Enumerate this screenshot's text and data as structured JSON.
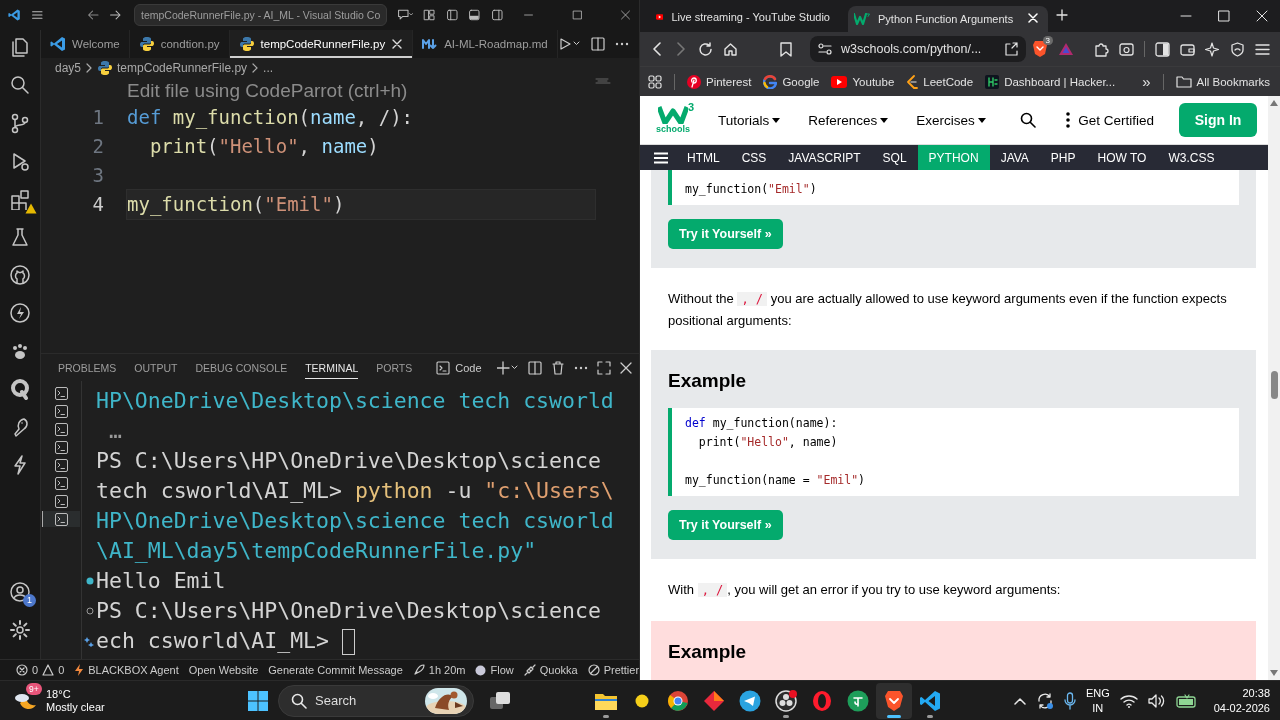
{
  "vscode": {
    "title": "tempCodeRunnerFile.py - AI_ML - Visual Studio Co",
    "extensions_warning": true,
    "account_badge": "1",
    "tabs": [
      {
        "label": "Welcome",
        "kind": "welcome",
        "selected": false
      },
      {
        "label": "condtion.py",
        "kind": "python",
        "selected": false
      },
      {
        "label": "tempCodeRunnerFile.py",
        "kind": "python",
        "selected": true
      },
      {
        "label": "AI-ML-Roadmap.md",
        "kind": "markdown",
        "selected": false
      }
    ],
    "breadcrumb": [
      "day5",
      "tempCodeRunnerFile.py",
      "..."
    ],
    "hint": "Edit file using CodeParrot (ctrl+h)",
    "lines": [
      {
        "number": "1",
        "current": false,
        "tokens": [
          {
            "kind": "kw",
            "text": "def "
          },
          {
            "kind": "fn",
            "text": "my_function"
          },
          {
            "kind": "plain",
            "text": "("
          },
          {
            "kind": "param",
            "text": "name"
          },
          {
            "kind": "plain",
            "text": ", /):"
          }
        ]
      },
      {
        "number": "2",
        "current": false,
        "tokens": [
          {
            "kind": "fn",
            "text": "  print"
          },
          {
            "kind": "plain",
            "text": "("
          },
          {
            "kind": "str",
            "text": "\"Hello\""
          },
          {
            "kind": "plain",
            "text": ", "
          },
          {
            "kind": "param",
            "text": "name"
          },
          {
            "kind": "plain",
            "text": ")"
          }
        ]
      },
      {
        "number": "3",
        "current": false
      },
      {
        "number": "4",
        "current": true,
        "tokens": [
          {
            "kind": "fn",
            "text": "my_function"
          },
          {
            "kind": "plain",
            "text": "("
          },
          {
            "kind": "str",
            "text": "\"Emil\""
          },
          {
            "kind": "plain",
            "text": ")"
          }
        ]
      }
    ],
    "panel_tabs": [
      {
        "label": "PROBLEMS",
        "selected": false
      },
      {
        "label": "OUTPUT",
        "selected": false
      },
      {
        "label": "DEBUG CONSOLE",
        "selected": false
      },
      {
        "label": "TERMINAL",
        "selected": true
      },
      {
        "label": "PORTS",
        "selected": false
      }
    ],
    "terminal_label": "Code",
    "terminal_instances": [
      {
        "selected": false
      },
      {
        "selected": false
      },
      {
        "selected": false
      },
      {
        "selected": false
      },
      {
        "selected": false
      },
      {
        "selected": false
      },
      {
        "selected": false
      },
      {
        "selected": true
      }
    ],
    "terminal_lines": [
      {
        "kind": "output",
        "segments": [
          {
            "kind": "path",
            "text": "HP\\OneDrive\\Desktop\\science tech csworld"
          }
        ]
      },
      {
        "kind": "output",
        "segments": [
          {
            "kind": "dim",
            "text": " …"
          }
        ]
      },
      {
        "kind": "output",
        "segments": [
          {
            "kind": "plain",
            "text": "PS C:\\Users\\HP\\OneDrive\\Desktop\\science"
          }
        ]
      },
      {
        "kind": "output",
        "segments": [
          {
            "kind": "plain",
            "text": "tech csworld\\AI_ML> "
          },
          {
            "kind": "cmd",
            "text": "python"
          },
          {
            "kind": "plain",
            "text": " -u "
          },
          {
            "kind": "str",
            "text": "\"c:\\Users\\"
          }
        ]
      },
      {
        "kind": "output",
        "segments": [
          {
            "kind": "path",
            "text": "HP\\OneDrive\\Desktop\\science tech csworld"
          }
        ]
      },
      {
        "kind": "output",
        "segments": [
          {
            "kind": "path",
            "text": "\\AI_ML\\day5\\tempCodeRunnerFile.py\""
          }
        ]
      },
      {
        "kind": "success",
        "segments": [
          {
            "kind": "plain",
            "text": "Hello Emil"
          }
        ]
      },
      {
        "kind": "idle",
        "segments": [
          {
            "kind": "plain",
            "text": "PS C:\\Users\\HP\\OneDrive\\Desktop\\science"
          }
        ]
      },
      {
        "kind": "sparkle",
        "cursor": true,
        "segments": [
          {
            "kind": "plain",
            "text": "ech csworld\\AI_ML> "
          }
        ]
      }
    ],
    "status_items": [
      {
        "kind": "problems",
        "errors": "0",
        "warnings": "0"
      },
      {
        "kind": "agent",
        "label": "BLACKBOX Agent"
      },
      {
        "kind": "text",
        "label": "Open Website"
      },
      {
        "kind": "text",
        "label": "Generate Commit Message"
      },
      {
        "kind": "timer",
        "label": "1h 20m"
      },
      {
        "kind": "flow",
        "label": "Flow"
      },
      {
        "kind": "plug",
        "label": "Quokka"
      },
      {
        "kind": "prettier",
        "label": "Prettier"
      }
    ]
  },
  "browser": {
    "tabs": [
      {
        "title": "Live streaming - YouTube Studio",
        "kind": "youtube",
        "selected": false
      },
      {
        "title": "Python Function Arguments",
        "kind": "w3",
        "selected": true
      }
    ],
    "url": "w3schools.com/python/...",
    "shield_count": "3",
    "bookmarks": [
      {
        "label": "Pinterest",
        "kind": "pinterest"
      },
      {
        "label": "Google",
        "kind": "google"
      },
      {
        "label": "Youtube",
        "kind": "youtube"
      },
      {
        "label": "LeetCode",
        "kind": "leetcode"
      },
      {
        "label": "Dashboard | Hacker...",
        "kind": "hacker"
      }
    ],
    "bookmarks_more": "»",
    "all_bookmarks": "All Bookmarks"
  },
  "page": {
    "logo": {
      "sup": "3",
      "word": "schools"
    },
    "menus": [
      "Tutorials",
      "References",
      "Exercises"
    ],
    "get_certified": "Get Certified",
    "sign_in": "Sign In",
    "subnav": [
      {
        "label": "HTML",
        "selected": false
      },
      {
        "label": "CSS",
        "selected": false
      },
      {
        "label": "JAVASCRIPT",
        "selected": false
      },
      {
        "label": "SQL",
        "selected": false
      },
      {
        "label": "PYTHON",
        "selected": true
      },
      {
        "label": "JAVA",
        "selected": false
      },
      {
        "label": "PHP",
        "selected": false
      },
      {
        "label": "HOW TO",
        "selected": false
      },
      {
        "label": "W3.CSS",
        "selected": false
      }
    ],
    "blocks": [
      {
        "kind": "example",
        "code": [
          {
            "kind": "code",
            "tokens": [
              {
                "kind": "plain",
                "text": "my_function("
              },
              {
                "kind": "str",
                "text": "\"Emil\""
              },
              {
                "kind": "plain",
                "text": ")"
              }
            ]
          }
        ],
        "button": "Try it Yourself »"
      },
      {
        "kind": "paragraph",
        "parts": [
          {
            "kind": "text",
            "text": "Without the "
          },
          {
            "kind": "code",
            "text": ", /"
          },
          {
            "kind": "text",
            "text": " you are actually allowed to use keyword arguments even if the function expects positional arguments:"
          }
        ]
      },
      {
        "kind": "example",
        "heading": "Example",
        "code": [
          {
            "kind": "code",
            "tokens": [
              {
                "kind": "kw",
                "text": "def"
              },
              {
                "kind": "plain",
                "text": " my_function(name):"
              }
            ]
          },
          {
            "kind": "code",
            "tokens": [
              {
                "kind": "plain",
                "text": "  print("
              },
              {
                "kind": "str",
                "text": "\"Hello\""
              },
              {
                "kind": "plain",
                "text": ", name)"
              }
            ]
          },
          {
            "kind": "blank"
          },
          {
            "kind": "code",
            "tokens": [
              {
                "kind": "plain",
                "text": "my_function(name = "
              },
              {
                "kind": "str",
                "text": "\"Emil\""
              },
              {
                "kind": "plain",
                "text": ")"
              }
            ]
          }
        ],
        "button": "Try it Yourself »"
      },
      {
        "kind": "paragraph",
        "parts": [
          {
            "kind": "text",
            "text": "With "
          },
          {
            "kind": "code",
            "text": ", /"
          },
          {
            "kind": "text",
            "text": ", you will get an error if you try to use keyword arguments:"
          }
        ]
      },
      {
        "kind": "error_example",
        "heading": "Example"
      }
    ]
  },
  "taskbar": {
    "weather": {
      "temp": "18°C",
      "condition": "Mostly clear",
      "badge": "9+"
    },
    "search": "Search",
    "apps": [
      {
        "kind": "taskview",
        "running": false,
        "selected": false
      },
      {
        "kind": "explorer",
        "running": true,
        "selected": false
      },
      {
        "kind": "sticky",
        "running": false,
        "selected": false
      },
      {
        "kind": "chrome",
        "running": false,
        "selected": false
      },
      {
        "kind": "diamond",
        "running": false,
        "selected": false
      },
      {
        "kind": "telegram",
        "running": false,
        "selected": false
      },
      {
        "kind": "obs",
        "running": true,
        "selected": false
      },
      {
        "kind": "opera",
        "running": false,
        "selected": false
      },
      {
        "kind": "greenapp",
        "running": false,
        "selected": false
      },
      {
        "kind": "brave",
        "running": true,
        "selected": true
      },
      {
        "kind": "vscode",
        "running": true,
        "selected": false
      }
    ],
    "tray": {
      "lang": "ENG",
      "region": "IN",
      "time": "20:38",
      "date": "04-02-2026"
    }
  }
}
